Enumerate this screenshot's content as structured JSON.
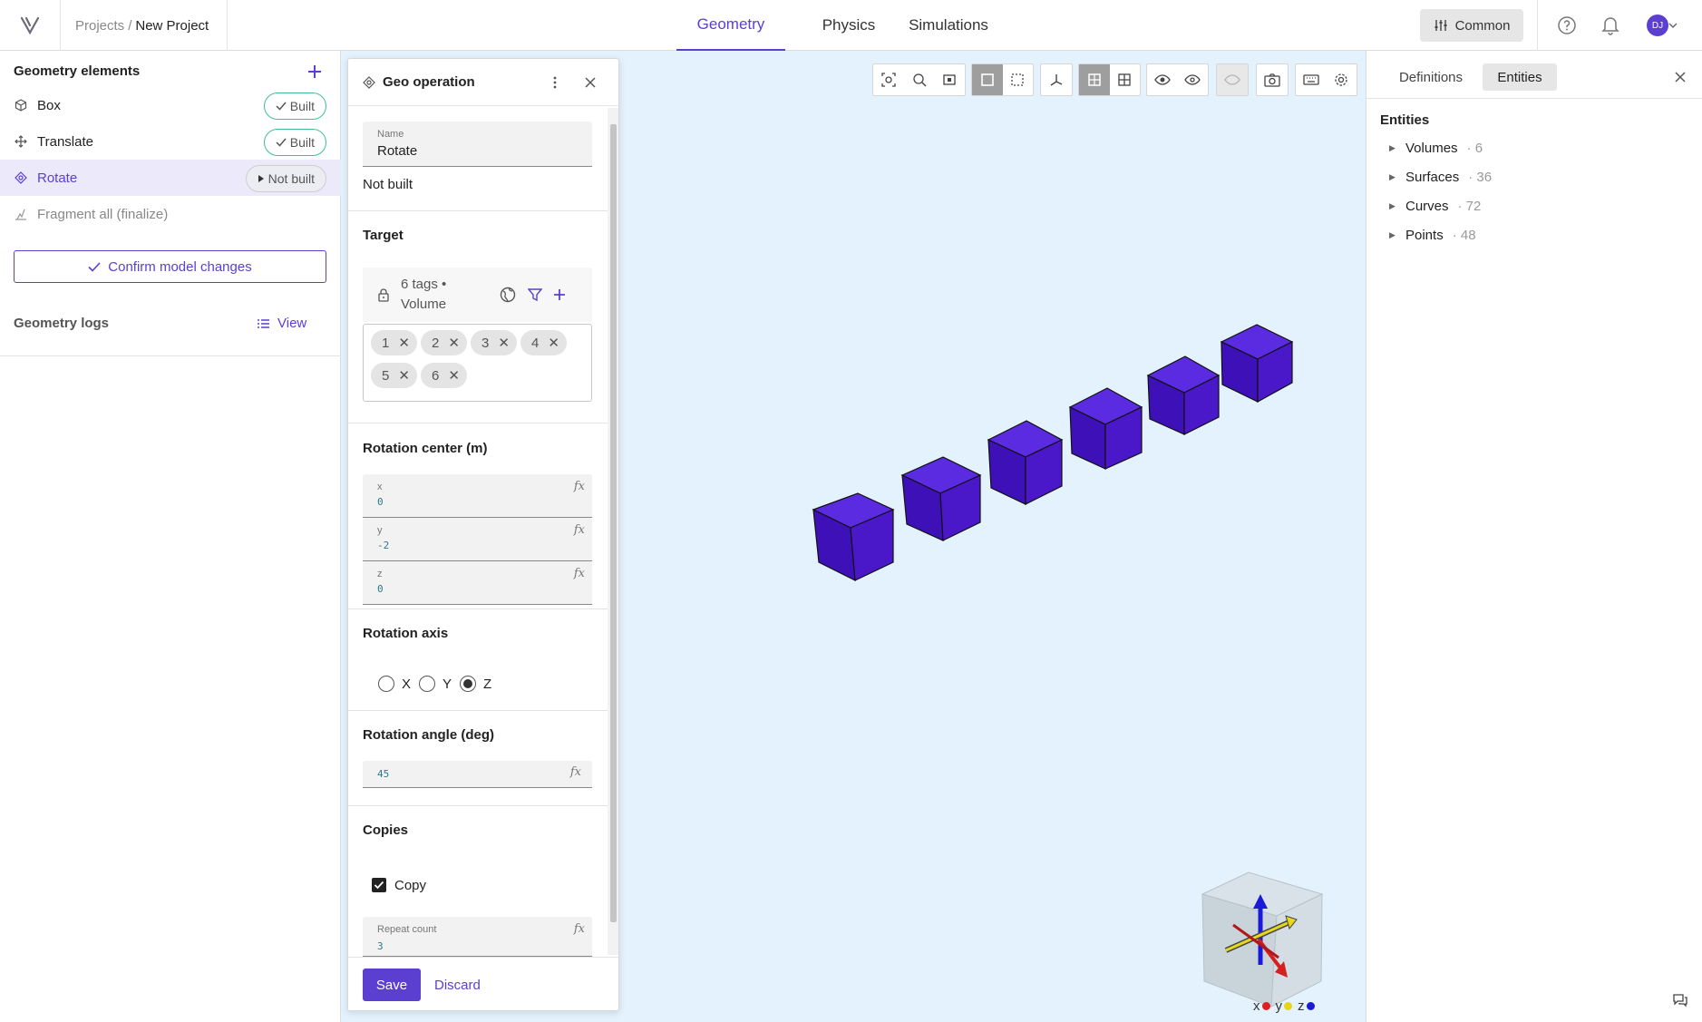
{
  "app": {
    "breadcrumb_root": "Projects",
    "breadcrumb_sep": "/",
    "breadcrumb_current": "New Project",
    "user_initials": "DJ"
  },
  "nav": {
    "tabs": [
      {
        "label": "Geometry",
        "active": true
      },
      {
        "label": "Physics",
        "active": false
      },
      {
        "label": "Simulations",
        "active": false
      }
    ],
    "common_label": "Common"
  },
  "left": {
    "title": "Geometry elements",
    "items": [
      {
        "label": "Box",
        "status": "Built",
        "icon": "cube-icon"
      },
      {
        "label": "Translate",
        "status": "Built",
        "icon": "move-icon"
      },
      {
        "label": "Rotate",
        "status": "Not built",
        "icon": "rotate-icon"
      },
      {
        "label": "Fragment all (finalize)",
        "status": "",
        "icon": "fragment-icon"
      }
    ],
    "confirm_label": "Confirm model changes",
    "logs_label": "Geometry logs",
    "logs_view": "View"
  },
  "geo": {
    "title": "Geo operation",
    "name_label": "Name",
    "name_value": "Rotate",
    "status": "Not built",
    "target_title": "Target",
    "target_tags_line1": "6 tags •",
    "target_tags_line2": "Volume",
    "chips": [
      "1",
      "2",
      "3",
      "4",
      "5",
      "6"
    ],
    "center_title": "Rotation center (m)",
    "center": {
      "x_label": "x",
      "x_value": "0",
      "y_label": "y",
      "y_value": "-2",
      "z_label": "z",
      "z_value": "0"
    },
    "axis_title": "Rotation axis",
    "axis_options": [
      "X",
      "Y",
      "Z"
    ],
    "axis_selected": "Z",
    "angle_title": "Rotation angle (deg)",
    "angle_value": "45",
    "copies_title": "Copies",
    "copy_label": "Copy",
    "copy_checked": true,
    "repeat_label": "Repeat count",
    "repeat_value": "3",
    "fx": "fx",
    "save_label": "Save",
    "discard_label": "Discard"
  },
  "right": {
    "tabs": [
      {
        "label": "Definitions",
        "active": false
      },
      {
        "label": "Entities",
        "active": true
      }
    ],
    "entities_title": "Entities",
    "rows": [
      {
        "label": "Volumes",
        "count": "· 6"
      },
      {
        "label": "Surfaces",
        "count": "· 36"
      },
      {
        "label": "Curves",
        "count": "· 72"
      },
      {
        "label": "Points",
        "count": "· 48"
      }
    ]
  },
  "axes": {
    "x": "x",
    "y": "y",
    "z": "z"
  },
  "colors": {
    "accent": "#5b3fd1",
    "built": "#3fc08e",
    "viewport_bg": "#e3f2fd",
    "cube": "#4a17c9"
  }
}
